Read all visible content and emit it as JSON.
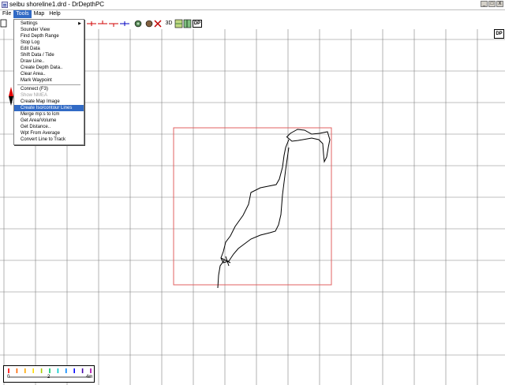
{
  "window": {
    "title": "seibu shoreline1.drd - DrDepthPC",
    "buttons": [
      "_",
      "□",
      "X"
    ]
  },
  "menubar": [
    "File",
    "Tools",
    "Map",
    "Help"
  ],
  "active_menu": "Tools",
  "toolbar": {
    "three_d_label": "3D",
    "logo": "DP"
  },
  "tools_menu": {
    "items": [
      {
        "label": "Settings",
        "submenu": true
      },
      {
        "label": "Sounder View"
      },
      {
        "label": "Find Depth Range"
      },
      {
        "label": "Stop Log"
      },
      {
        "label": "Edit Data"
      },
      {
        "label": "Shift Data / Tide"
      },
      {
        "label": "Draw Line.."
      },
      {
        "label": "Create Depth Data.."
      },
      {
        "label": "Clear Area.."
      },
      {
        "label": "Mark Waypoint"
      },
      {
        "label": "Connect (F3)"
      },
      {
        "label": "Show NMEA",
        "disabled": true
      },
      {
        "label": "Create Map Image"
      },
      {
        "label": "Create Iso/contour Lines",
        "highlighted": true
      },
      {
        "label": "Merge mp:s to lcm"
      },
      {
        "label": "Get Area/Volume"
      },
      {
        "label": "Get Distance.."
      },
      {
        "label": "Wpt From Average"
      },
      {
        "label": "Convert Line to Track"
      }
    ]
  },
  "scale": {
    "labels": [
      "0",
      "2",
      "4m"
    ],
    "colors": [
      "#ff0000",
      "#ff6600",
      "#ffaa00",
      "#ffdd00",
      "#aacc00",
      "#00cc66",
      "#00cccc",
      "#0088ff",
      "#0000ff",
      "#4400aa",
      "#aa00aa"
    ]
  },
  "colors": {
    "grid": "#808080",
    "bounds": "#e06060",
    "highlight": "#316ac5"
  }
}
